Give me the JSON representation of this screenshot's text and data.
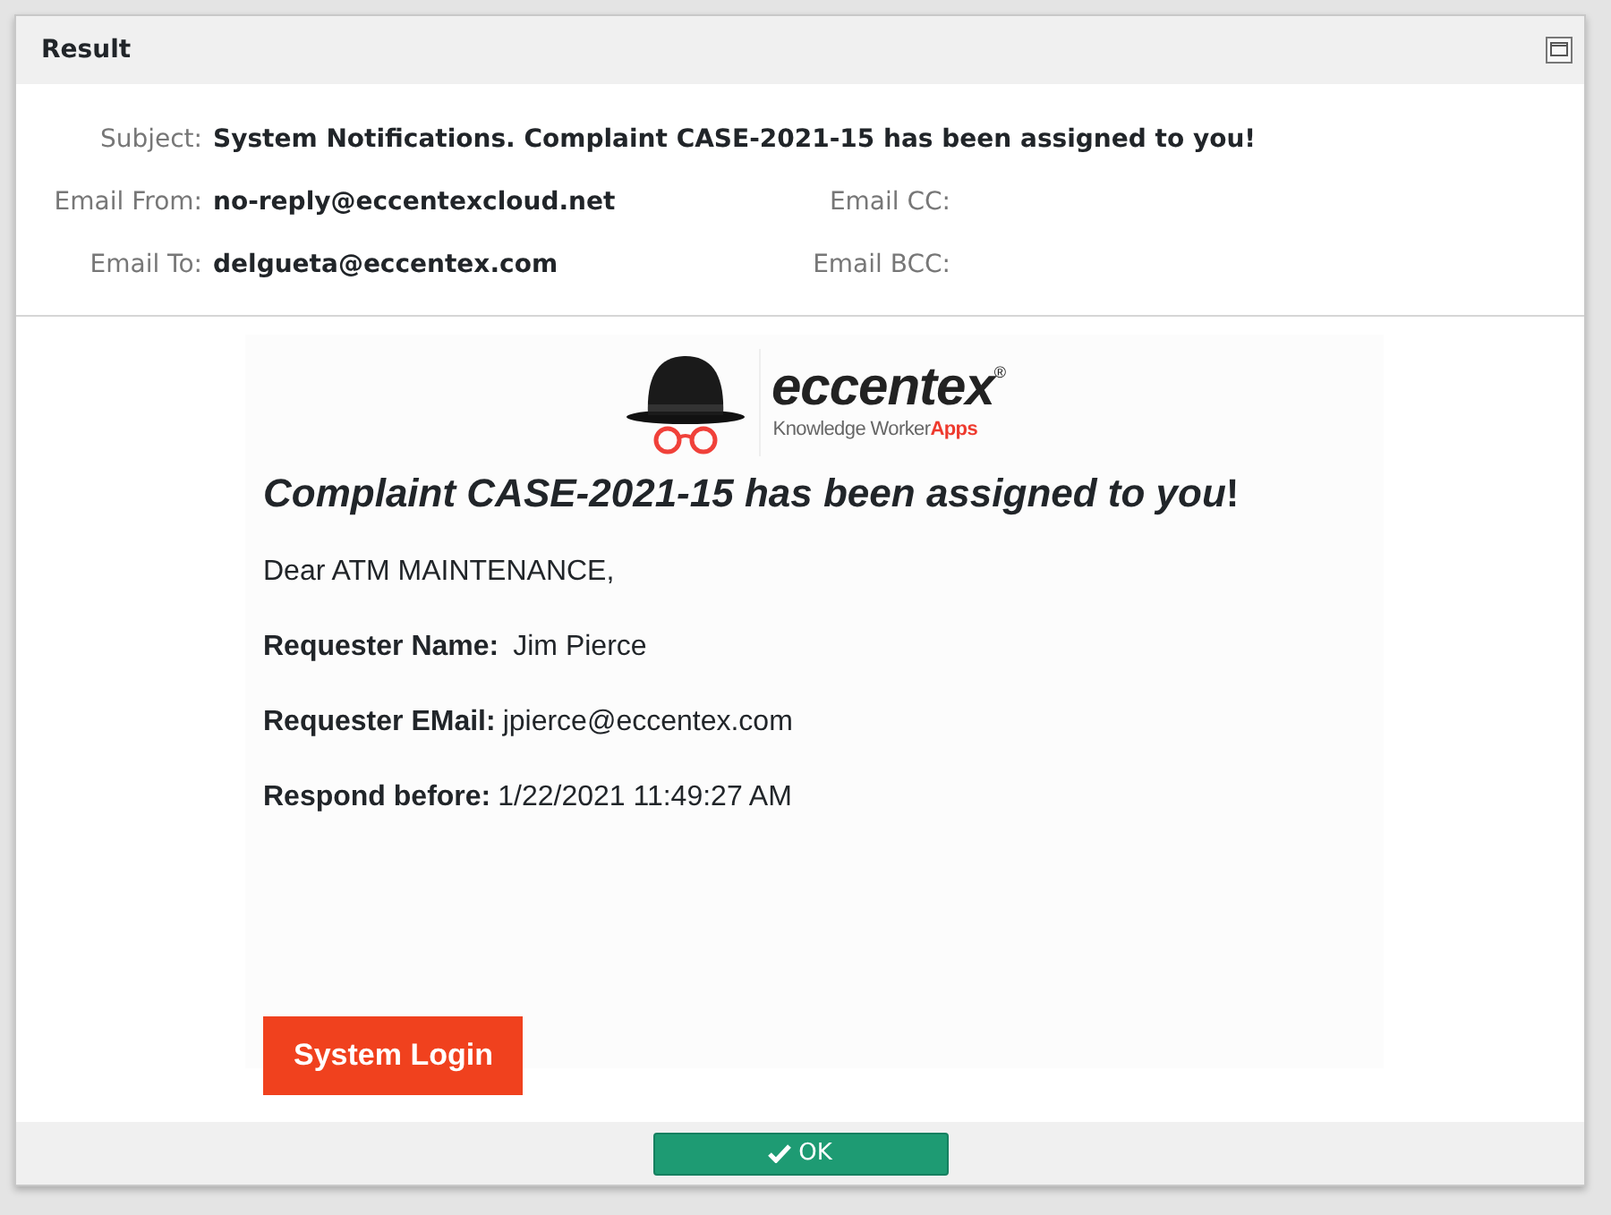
{
  "dialog": {
    "title": "Result"
  },
  "header_fields": [
    [
      {
        "label": "Subject:",
        "value": "System Notifications. Complaint CASE-2021-15 has been assigned to you!"
      }
    ],
    [
      {
        "label": "Email From:",
        "value": "no-reply@eccentexcloud.net"
      },
      {
        "label": "Email CC:"
      }
    ],
    [
      {
        "label": "Email To:",
        "value": "delgueta@eccentex.com"
      },
      {
        "label": "Email BCC:"
      }
    ]
  ],
  "email": {
    "logo": {
      "wordmark": "eccentex",
      "registered": "®",
      "tagline": "Knowledge Worker",
      "tagline_accent": "Apps"
    },
    "heading": "*Complaint CASE-2021-15 has been assigned to you*!",
    "greeting": "Dear ATM MAINTENANCE,",
    "fields": [
      {
        "label": "Requester Name:",
        "value": "Jim Pierce"
      },
      {
        "label": "Requester EMail:",
        "value": "jpierce@eccentex.com"
      },
      {
        "label": "Respond before:",
        "value": "1/22/2021 11:49:27 AM"
      }
    ],
    "login_button": "System Login"
  },
  "footer": {
    "ok_button": "OK"
  }
}
